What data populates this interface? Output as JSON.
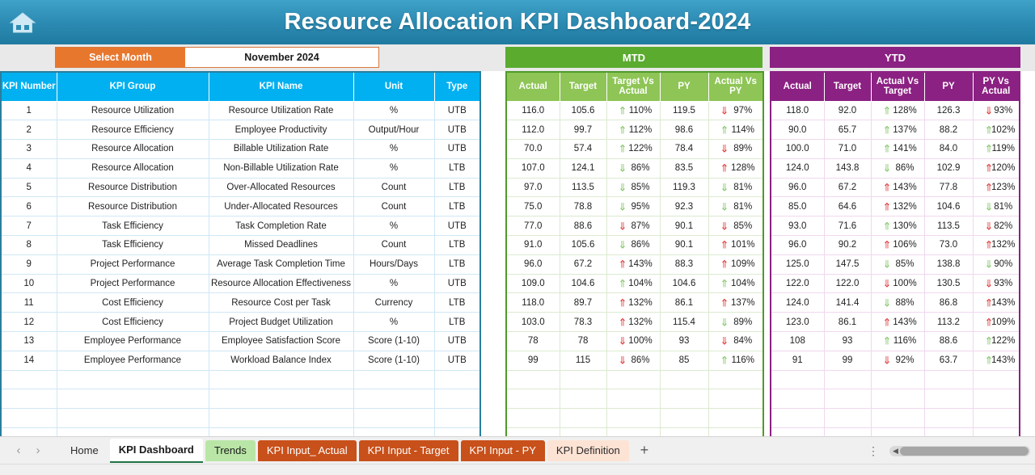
{
  "header": {
    "title": "Resource Allocation KPI Dashboard-2024",
    "home_icon": "home-icon"
  },
  "controls": {
    "select_month_label": "Select Month",
    "select_month_value": "November 2024"
  },
  "bands": {
    "mtd": "MTD",
    "ytd": "YTD"
  },
  "colors": {
    "title_blue": "#2d8cb4",
    "header_blue": "#00b0f0",
    "mtd_green": "#5aab2e",
    "mtd_header_green": "#8ec556",
    "ytd_purple": "#8b2182",
    "orange": "#e8772e",
    "arrow_good": "#7cc35f",
    "arrow_bad": "#e03030"
  },
  "table": {
    "left_headers": [
      "KPI Number",
      "KPI Group",
      "KPI Name",
      "Unit",
      "Type"
    ],
    "mtd_headers": [
      "Actual",
      "Target",
      "Target Vs Actual",
      "PY",
      "Actual Vs PY"
    ],
    "ytd_headers": [
      "Actual",
      "Target",
      "Actual Vs Target",
      "PY",
      "PY Vs Actual"
    ],
    "rows": [
      {
        "number": "1",
        "group": "Resource Utilization",
        "name": "Resource Utilization Rate",
        "unit": "%",
        "type": "UTB",
        "mtd": {
          "actual": "116.0",
          "target": "105.6",
          "cmp1_dir": "up",
          "cmp1_color": "good",
          "cmp1": "110%",
          "py": "119.5",
          "cmp2_dir": "down",
          "cmp2_color": "bad",
          "cmp2": "97%"
        },
        "ytd": {
          "actual": "118.0",
          "target": "92.0",
          "cmp1_dir": "up",
          "cmp1_color": "good",
          "cmp1": "128%",
          "py": "126.3",
          "cmp2_dir": "down",
          "cmp2_color": "bad",
          "cmp2": "93%"
        }
      },
      {
        "number": "2",
        "group": "Resource Efficiency",
        "name": "Employee Productivity",
        "unit": "Output/Hour",
        "type": "UTB",
        "mtd": {
          "actual": "112.0",
          "target": "99.7",
          "cmp1_dir": "up",
          "cmp1_color": "good",
          "cmp1": "112%",
          "py": "98.6",
          "cmp2_dir": "up",
          "cmp2_color": "good",
          "cmp2": "114%"
        },
        "ytd": {
          "actual": "90.0",
          "target": "65.7",
          "cmp1_dir": "up",
          "cmp1_color": "good",
          "cmp1": "137%",
          "py": "88.2",
          "cmp2_dir": "up",
          "cmp2_color": "good",
          "cmp2": "102%"
        }
      },
      {
        "number": "3",
        "group": "Resource Allocation",
        "name": "Billable Utilization Rate",
        "unit": "%",
        "type": "UTB",
        "mtd": {
          "actual": "70.0",
          "target": "57.4",
          "cmp1_dir": "up",
          "cmp1_color": "good",
          "cmp1": "122%",
          "py": "78.4",
          "cmp2_dir": "down",
          "cmp2_color": "bad",
          "cmp2": "89%"
        },
        "ytd": {
          "actual": "100.0",
          "target": "71.0",
          "cmp1_dir": "up",
          "cmp1_color": "good",
          "cmp1": "141%",
          "py": "84.0",
          "cmp2_dir": "up",
          "cmp2_color": "good",
          "cmp2": "119%"
        }
      },
      {
        "number": "4",
        "group": "Resource Allocation",
        "name": "Non-Billable Utilization Rate",
        "unit": "%",
        "type": "LTB",
        "mtd": {
          "actual": "107.0",
          "target": "124.1",
          "cmp1_dir": "down",
          "cmp1_color": "good",
          "cmp1": "86%",
          "py": "83.5",
          "cmp2_dir": "up",
          "cmp2_color": "bad",
          "cmp2": "128%"
        },
        "ytd": {
          "actual": "124.0",
          "target": "143.8",
          "cmp1_dir": "down",
          "cmp1_color": "good",
          "cmp1": "86%",
          "py": "102.9",
          "cmp2_dir": "up",
          "cmp2_color": "bad",
          "cmp2": "120%"
        }
      },
      {
        "number": "5",
        "group": "Resource Distribution",
        "name": "Over-Allocated Resources",
        "unit": "Count",
        "type": "LTB",
        "mtd": {
          "actual": "97.0",
          "target": "113.5",
          "cmp1_dir": "down",
          "cmp1_color": "good",
          "cmp1": "85%",
          "py": "119.3",
          "cmp2_dir": "down",
          "cmp2_color": "good",
          "cmp2": "81%"
        },
        "ytd": {
          "actual": "96.0",
          "target": "67.2",
          "cmp1_dir": "up",
          "cmp1_color": "bad",
          "cmp1": "143%",
          "py": "77.8",
          "cmp2_dir": "up",
          "cmp2_color": "bad",
          "cmp2": "123%"
        }
      },
      {
        "number": "6",
        "group": "Resource Distribution",
        "name": "Under-Allocated Resources",
        "unit": "Count",
        "type": "LTB",
        "mtd": {
          "actual": "75.0",
          "target": "78.8",
          "cmp1_dir": "down",
          "cmp1_color": "good",
          "cmp1": "95%",
          "py": "92.3",
          "cmp2_dir": "down",
          "cmp2_color": "good",
          "cmp2": "81%"
        },
        "ytd": {
          "actual": "85.0",
          "target": "64.6",
          "cmp1_dir": "up",
          "cmp1_color": "bad",
          "cmp1": "132%",
          "py": "104.6",
          "cmp2_dir": "down",
          "cmp2_color": "good",
          "cmp2": "81%"
        }
      },
      {
        "number": "7",
        "group": "Task Efficiency",
        "name": "Task Completion Rate",
        "unit": "%",
        "type": "UTB",
        "mtd": {
          "actual": "77.0",
          "target": "88.6",
          "cmp1_dir": "down",
          "cmp1_color": "bad",
          "cmp1": "87%",
          "py": "90.1",
          "cmp2_dir": "down",
          "cmp2_color": "bad",
          "cmp2": "85%"
        },
        "ytd": {
          "actual": "93.0",
          "target": "71.6",
          "cmp1_dir": "up",
          "cmp1_color": "good",
          "cmp1": "130%",
          "py": "113.5",
          "cmp2_dir": "down",
          "cmp2_color": "bad",
          "cmp2": "82%"
        }
      },
      {
        "number": "8",
        "group": "Task Efficiency",
        "name": "Missed Deadlines",
        "unit": "Count",
        "type": "LTB",
        "mtd": {
          "actual": "91.0",
          "target": "105.6",
          "cmp1_dir": "down",
          "cmp1_color": "good",
          "cmp1": "86%",
          "py": "90.1",
          "cmp2_dir": "up",
          "cmp2_color": "bad",
          "cmp2": "101%"
        },
        "ytd": {
          "actual": "96.0",
          "target": "90.2",
          "cmp1_dir": "up",
          "cmp1_color": "bad",
          "cmp1": "106%",
          "py": "73.0",
          "cmp2_dir": "up",
          "cmp2_color": "bad",
          "cmp2": "132%"
        }
      },
      {
        "number": "9",
        "group": "Project Performance",
        "name": "Average Task Completion Time",
        "unit": "Hours/Days",
        "type": "LTB",
        "mtd": {
          "actual": "96.0",
          "target": "67.2",
          "cmp1_dir": "up",
          "cmp1_color": "bad",
          "cmp1": "143%",
          "py": "88.3",
          "cmp2_dir": "up",
          "cmp2_color": "bad",
          "cmp2": "109%"
        },
        "ytd": {
          "actual": "125.0",
          "target": "147.5",
          "cmp1_dir": "down",
          "cmp1_color": "good",
          "cmp1": "85%",
          "py": "138.8",
          "cmp2_dir": "down",
          "cmp2_color": "good",
          "cmp2": "90%"
        }
      },
      {
        "number": "10",
        "group": "Project Performance",
        "name": "Resource Allocation Effectiveness",
        "unit": "%",
        "type": "UTB",
        "mtd": {
          "actual": "109.0",
          "target": "104.6",
          "cmp1_dir": "up",
          "cmp1_color": "good",
          "cmp1": "104%",
          "py": "104.6",
          "cmp2_dir": "up",
          "cmp2_color": "good",
          "cmp2": "104%"
        },
        "ytd": {
          "actual": "122.0",
          "target": "122.0",
          "cmp1_dir": "down",
          "cmp1_color": "bad",
          "cmp1": "100%",
          "py": "130.5",
          "cmp2_dir": "down",
          "cmp2_color": "bad",
          "cmp2": "93%"
        }
      },
      {
        "number": "11",
        "group": "Cost Efficiency",
        "name": "Resource Cost per Task",
        "unit": "Currency",
        "type": "LTB",
        "mtd": {
          "actual": "118.0",
          "target": "89.7",
          "cmp1_dir": "up",
          "cmp1_color": "bad",
          "cmp1": "132%",
          "py": "86.1",
          "cmp2_dir": "up",
          "cmp2_color": "bad",
          "cmp2": "137%"
        },
        "ytd": {
          "actual": "124.0",
          "target": "141.4",
          "cmp1_dir": "down",
          "cmp1_color": "good",
          "cmp1": "88%",
          "py": "86.8",
          "cmp2_dir": "up",
          "cmp2_color": "bad",
          "cmp2": "143%"
        }
      },
      {
        "number": "12",
        "group": "Cost Efficiency",
        "name": "Project Budget Utilization",
        "unit": "%",
        "type": "LTB",
        "mtd": {
          "actual": "103.0",
          "target": "78.3",
          "cmp1_dir": "up",
          "cmp1_color": "bad",
          "cmp1": "132%",
          "py": "115.4",
          "cmp2_dir": "down",
          "cmp2_color": "good",
          "cmp2": "89%"
        },
        "ytd": {
          "actual": "123.0",
          "target": "86.1",
          "cmp1_dir": "up",
          "cmp1_color": "bad",
          "cmp1": "143%",
          "py": "113.2",
          "cmp2_dir": "up",
          "cmp2_color": "bad",
          "cmp2": "109%"
        }
      },
      {
        "number": "13",
        "group": "Employee Performance",
        "name": "Employee Satisfaction Score",
        "unit": "Score (1-10)",
        "type": "UTB",
        "mtd": {
          "actual": "78",
          "target": "78",
          "cmp1_dir": "down",
          "cmp1_color": "bad",
          "cmp1": "100%",
          "py": "93",
          "cmp2_dir": "down",
          "cmp2_color": "bad",
          "cmp2": "84%"
        },
        "ytd": {
          "actual": "108",
          "target": "93",
          "cmp1_dir": "up",
          "cmp1_color": "good",
          "cmp1": "116%",
          "py": "88.6",
          "cmp2_dir": "up",
          "cmp2_color": "good",
          "cmp2": "122%"
        }
      },
      {
        "number": "14",
        "group": "Employee Performance",
        "name": "Workload Balance Index",
        "unit": "Score (1-10)",
        "type": "UTB",
        "mtd": {
          "actual": "99",
          "target": "115",
          "cmp1_dir": "down",
          "cmp1_color": "bad",
          "cmp1": "86%",
          "py": "85",
          "cmp2_dir": "up",
          "cmp2_color": "good",
          "cmp2": "116%"
        },
        "ytd": {
          "actual": "91",
          "target": "99",
          "cmp1_dir": "down",
          "cmp1_color": "bad",
          "cmp1": "92%",
          "py": "63.7",
          "cmp2_dir": "up",
          "cmp2_color": "good",
          "cmp2": "143%"
        }
      }
    ],
    "empty_row_count": 4
  },
  "sheet_tabs": {
    "prev_icon": "chevron-left-icon",
    "next_icon": "chevron-right-icon",
    "add_label": "+",
    "items": [
      {
        "label": "Home",
        "style": "plain"
      },
      {
        "label": "KPI Dashboard",
        "style": "active"
      },
      {
        "label": "Trends",
        "style": "green"
      },
      {
        "label": "KPI Input_ Actual",
        "style": "orange"
      },
      {
        "label": "KPI Input - Target",
        "style": "orange"
      },
      {
        "label": "KPI Input - PY",
        "style": "orange"
      },
      {
        "label": "KPI Definition",
        "style": "peach"
      }
    ],
    "more_icon": "kebab-menu-icon",
    "scroll_left_icon": "scroll-left-icon"
  }
}
